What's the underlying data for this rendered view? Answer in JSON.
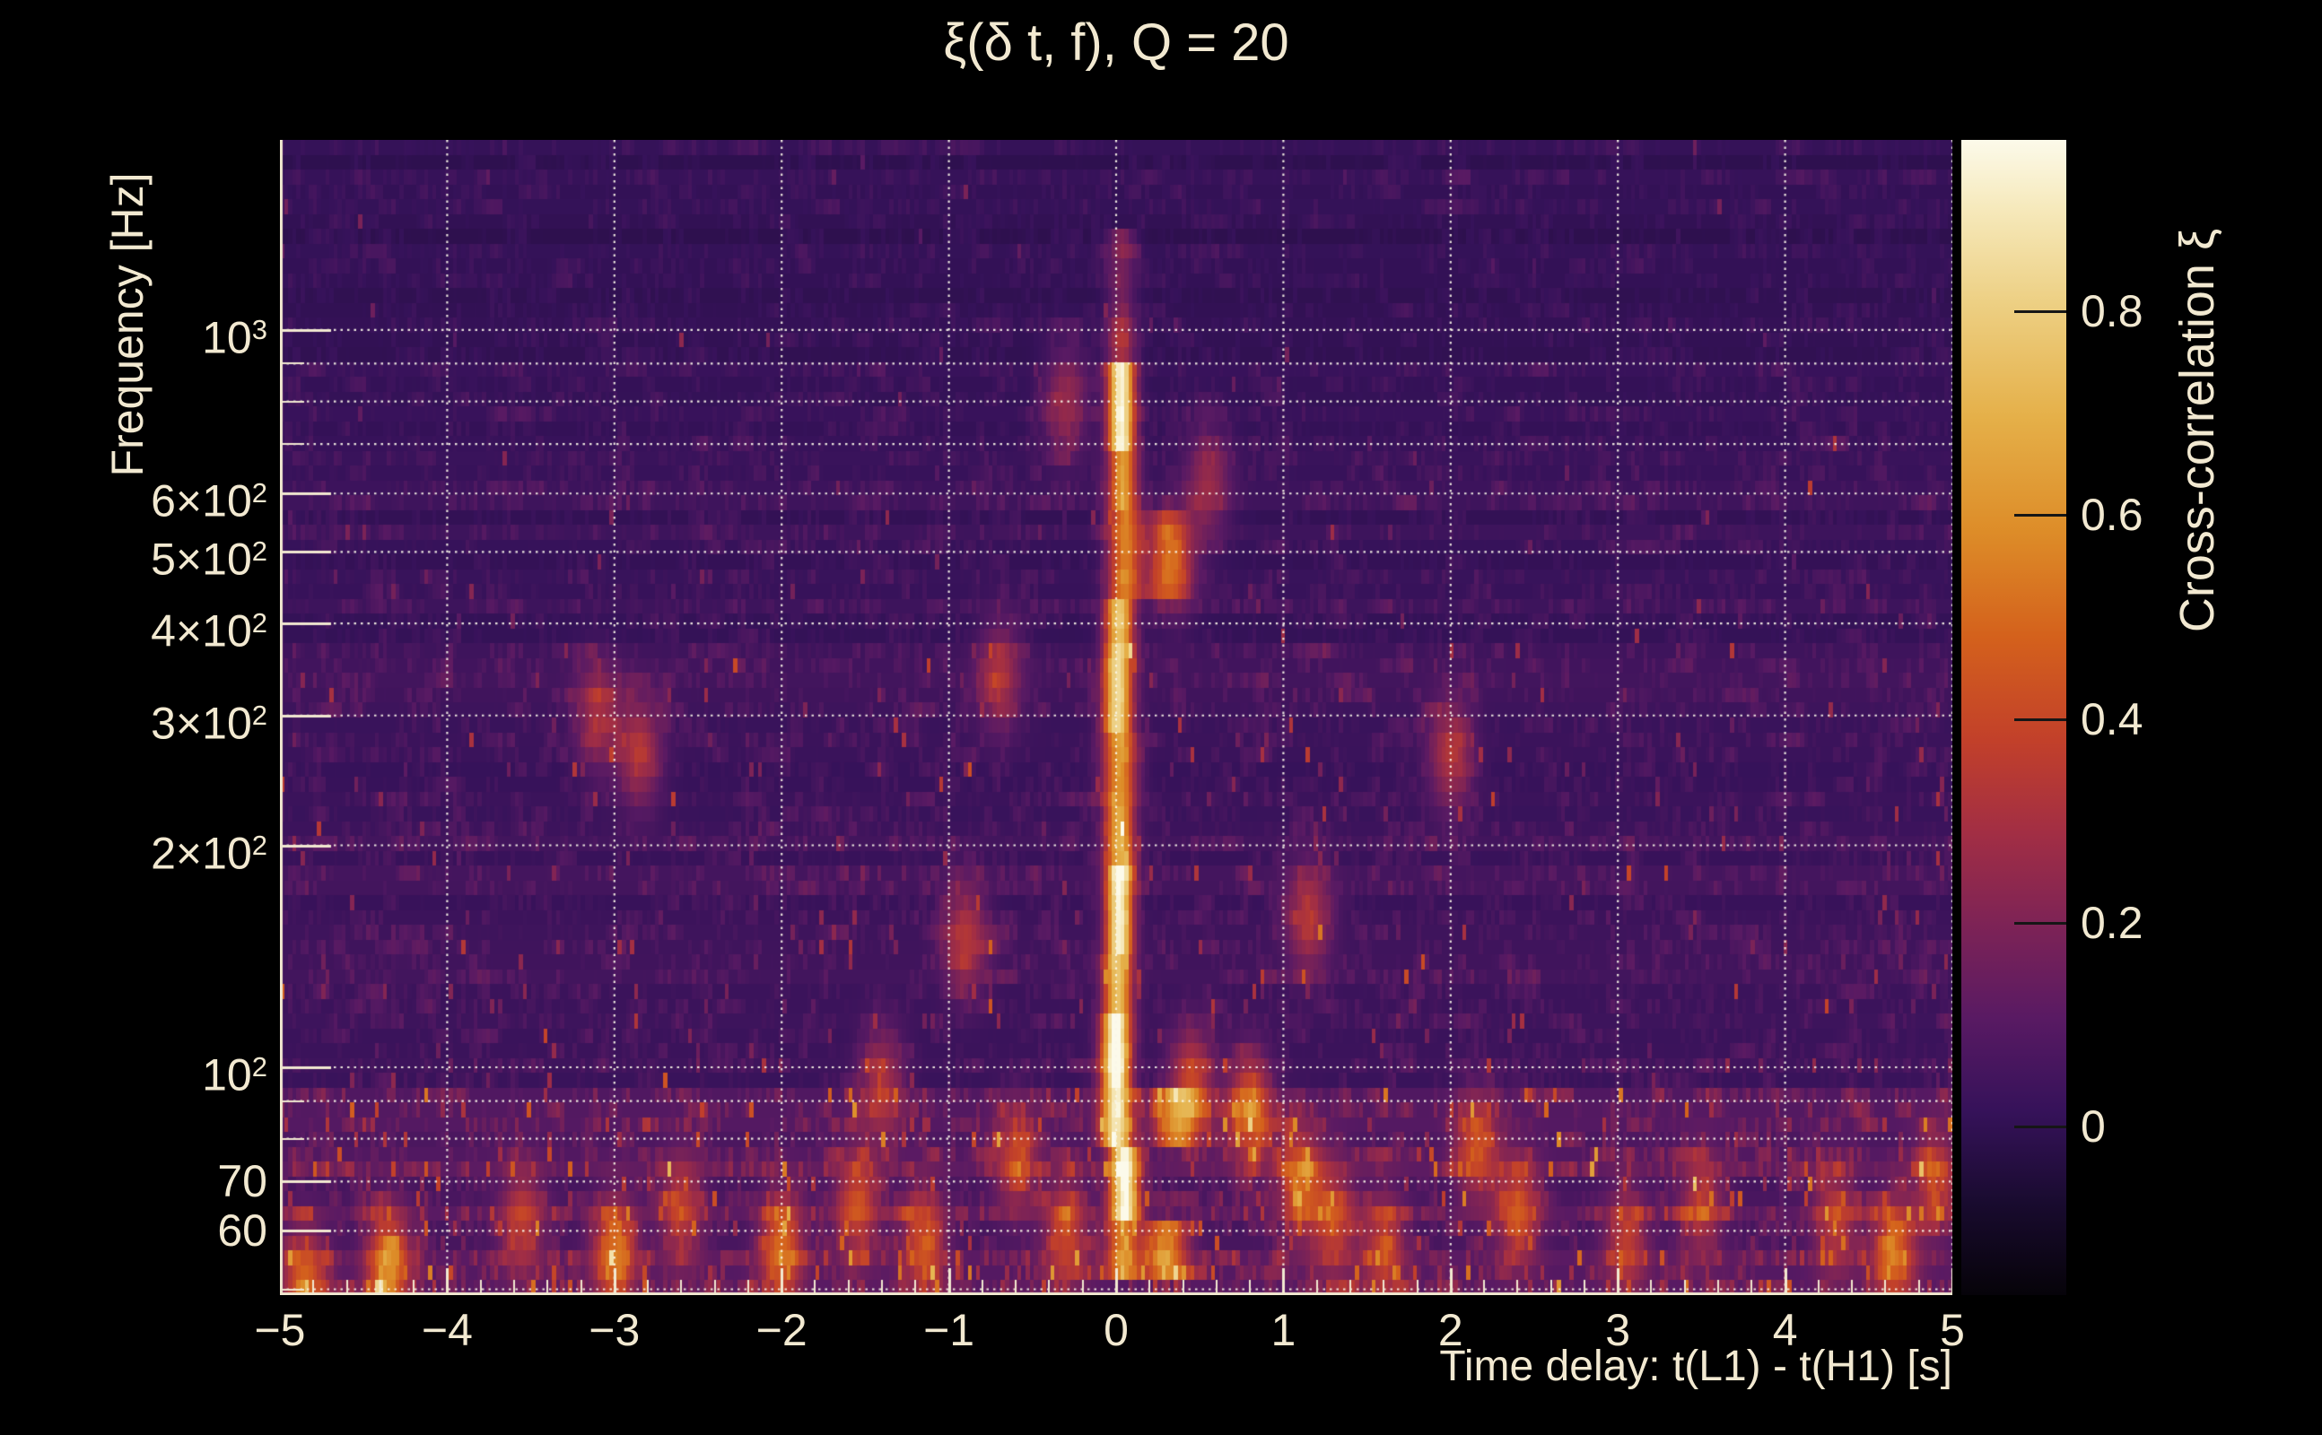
{
  "colors": {
    "background": "#000000",
    "text": "#f2e9d1",
    "axis": "#f2e9d1",
    "grid": "#faf5e6",
    "colorbar_tick": "#161616"
  },
  "chart_data": {
    "type": "heatmap",
    "title": "ξ(δ t, f), Q = 20",
    "xlabel": "Time delay: t(L1) - t(H1) [s]",
    "ylabel": "Frequency [Hz]",
    "colorbar_label": "Cross-correlation ξ",
    "x_axis": {
      "min": -5,
      "max": 5,
      "minor_step": 0.2,
      "ticks": [
        {
          "v": -5,
          "label": "−5"
        },
        {
          "v": -4,
          "label": "−4"
        },
        {
          "v": -3,
          "label": "−3"
        },
        {
          "v": -2,
          "label": "−2"
        },
        {
          "v": -1,
          "label": "−1"
        },
        {
          "v": 0,
          "label": "0"
        },
        {
          "v": 1,
          "label": "1"
        },
        {
          "v": 2,
          "label": "2"
        },
        {
          "v": 3,
          "label": "3"
        },
        {
          "v": 4,
          "label": "4"
        },
        {
          "v": 5,
          "label": "5"
        }
      ]
    },
    "y_axis": {
      "scale": "log",
      "min": 49.1,
      "max": 1810,
      "ticks": [
        {
          "v": 1000,
          "pre": "10",
          "sup": "3"
        },
        {
          "v": 600,
          "pre": "6×10",
          "sup": "2"
        },
        {
          "v": 500,
          "pre": "5×10",
          "sup": "2"
        },
        {
          "v": 400,
          "pre": "4×10",
          "sup": "2"
        },
        {
          "v": 300,
          "pre": "3×10",
          "sup": "2"
        },
        {
          "v": 200,
          "pre": "2×10",
          "sup": "2"
        },
        {
          "v": 100,
          "pre": "10",
          "sup": "2"
        },
        {
          "v": 70,
          "pre": "70"
        },
        {
          "v": 60,
          "pre": "60"
        }
      ],
      "minor_ticks": [
        50,
        80,
        90,
        700,
        800,
        900
      ],
      "gridlines": [
        50,
        60,
        70,
        80,
        90,
        100,
        200,
        300,
        400,
        500,
        600,
        700,
        800,
        900,
        1000
      ]
    },
    "colorbar": {
      "vmin": -0.165,
      "vmax": 0.968,
      "ticks": [
        {
          "v": 0.8,
          "label": "0.8"
        },
        {
          "v": 0.6,
          "label": "0.6"
        },
        {
          "v": 0.4,
          "label": "0.4"
        },
        {
          "v": 0.2,
          "label": "0.2"
        },
        {
          "v": 0.0,
          "label": "0"
        }
      ],
      "colormap": [
        [
          0.0,
          "#060309"
        ],
        [
          0.08,
          "#190b2f"
        ],
        [
          0.16,
          "#36125a"
        ],
        [
          0.24,
          "#591a63"
        ],
        [
          0.32,
          "#7d2356"
        ],
        [
          0.4,
          "#a22e44"
        ],
        [
          0.48,
          "#c2402a"
        ],
        [
          0.57,
          "#d4611c"
        ],
        [
          0.66,
          "#dd8c28"
        ],
        [
          0.76,
          "#e5b049"
        ],
        [
          0.86,
          "#edd084"
        ],
        [
          0.94,
          "#f6e9bb"
        ],
        [
          1.0,
          "#fcfaea"
        ]
      ]
    },
    "signal_segments": [
      {
        "f_lo": 1020,
        "f_hi": 1400,
        "t": 0.03,
        "sigma": 0.06,
        "peak": 0.17
      },
      {
        "f_lo": 900,
        "f_hi": 1020,
        "t": 0.03,
        "sigma": 0.06,
        "peak": 0.3
      },
      {
        "f_lo": 680,
        "f_hi": 900,
        "t": 0.03,
        "sigma": 0.055,
        "peak": 0.93
      },
      {
        "f_lo": 560,
        "f_hi": 680,
        "t": 0.04,
        "sigma": 0.06,
        "peak": 0.6
      },
      {
        "f_lo": 430,
        "f_hi": 560,
        "t": 0.05,
        "sigma": 0.07,
        "peak": 0.52,
        "echo_t": 0.3,
        "echo_peak": 0.26
      },
      {
        "f_lo": 360,
        "f_hi": 430,
        "t": 0.02,
        "sigma": 0.06,
        "peak": 0.74
      },
      {
        "f_lo": 290,
        "f_hi": 360,
        "t": 0.01,
        "sigma": 0.06,
        "peak": 0.8
      },
      {
        "f_lo": 230,
        "f_hi": 290,
        "t": 0.02,
        "sigma": 0.07,
        "peak": 0.58
      },
      {
        "f_lo": 185,
        "f_hi": 230,
        "t": 0.02,
        "sigma": 0.06,
        "peak": 0.66
      },
      {
        "f_lo": 140,
        "f_hi": 185,
        "t": 0.02,
        "sigma": 0.055,
        "peak": 0.9
      },
      {
        "f_lo": 118,
        "f_hi": 140,
        "t": 0.01,
        "sigma": 0.06,
        "peak": 0.72
      },
      {
        "f_lo": 93,
        "f_hi": 118,
        "t": 0.0,
        "sigma": 0.06,
        "peak": 0.96
      },
      {
        "f_lo": 79,
        "f_hi": 93,
        "t": 0.0,
        "sigma": 0.065,
        "peak": 0.8,
        "echo_t": 0.35,
        "echo_peak": 0.42
      },
      {
        "f_lo": 61,
        "f_hi": 79,
        "t": 0.05,
        "sigma": 0.06,
        "peak": 0.88
      },
      {
        "f_lo": 52,
        "f_hi": 61,
        "t": 0.04,
        "sigma": 0.07,
        "peak": 0.5,
        "echo_t": 0.3,
        "echo_peak": 0.48
      }
    ],
    "blobs": [
      [
        -4.85,
        51,
        0.4
      ],
      [
        -4.35,
        54,
        0.5
      ],
      [
        -3.55,
        62,
        0.3
      ],
      [
        -3.1,
        300,
        0.26
      ],
      [
        -3.0,
        56,
        0.46
      ],
      [
        -2.85,
        268,
        0.3
      ],
      [
        -2.6,
        64,
        0.3
      ],
      [
        -2.0,
        57,
        0.44
      ],
      [
        -1.55,
        65,
        0.36
      ],
      [
        -1.4,
        95,
        0.28
      ],
      [
        -1.15,
        58,
        0.36
      ],
      [
        -0.9,
        150,
        0.3
      ],
      [
        -0.7,
        340,
        0.27
      ],
      [
        -0.6,
        75,
        0.3
      ],
      [
        -0.3,
        800,
        0.24
      ],
      [
        -0.3,
        60,
        0.34
      ],
      [
        0.35,
        480,
        0.26
      ],
      [
        0.45,
        95,
        0.38
      ],
      [
        0.55,
        620,
        0.24
      ],
      [
        0.8,
        88,
        0.46
      ],
      [
        1.1,
        70,
        0.42
      ],
      [
        1.15,
        160,
        0.3
      ],
      [
        1.3,
        62,
        0.34
      ],
      [
        1.6,
        57,
        0.32
      ],
      [
        2.0,
        265,
        0.3
      ],
      [
        2.15,
        78,
        0.34
      ],
      [
        2.4,
        64,
        0.36
      ],
      [
        3.05,
        58,
        0.3
      ],
      [
        3.5,
        65,
        0.28
      ],
      [
        4.3,
        62,
        0.3
      ],
      [
        4.65,
        56,
        0.44
      ],
      [
        4.9,
        70,
        0.3
      ]
    ],
    "noise": {
      "base": -0.05,
      "bands": [
        {
          "f_max": 55,
          "act": 2.0,
          "p": 0.1
        },
        {
          "f_max": 95,
          "act": 1.8,
          "p": 0.055
        },
        {
          "f_max": 135,
          "act": 1.3,
          "p": 0.028
        },
        {
          "f_max": 380,
          "act": 1.15,
          "p": 0.02
        },
        {
          "f_max": 700,
          "act": 1.0,
          "p": 0.01
        },
        {
          "f_max": 1100,
          "act": 0.85,
          "p": 0.006
        },
        {
          "f_max": 2000,
          "act": 0.72,
          "p": 0.004
        }
      ]
    }
  }
}
